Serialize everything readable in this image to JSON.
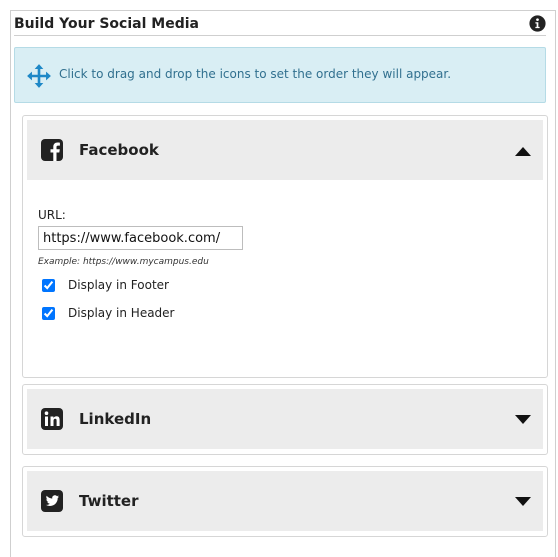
{
  "panel": {
    "title": "Build Your Social Media",
    "info_icon": "info-icon"
  },
  "notice": {
    "icon": "move-arrows-icon",
    "text": "Click to drag and drop the icons to set the order they will appear."
  },
  "accordions": [
    {
      "id": "facebook",
      "title": "Facebook",
      "icon": "facebook-icon",
      "expanded": true,
      "url_label": "URL:",
      "url_value": "https://www.facebook.com/",
      "example_text": "Example: https://www.mycampus.edu",
      "options": [
        {
          "label": "Display in Footer",
          "checked": true
        },
        {
          "label": "Display in Header",
          "checked": true
        }
      ]
    },
    {
      "id": "linkedin",
      "title": "LinkedIn",
      "icon": "linkedin-icon",
      "expanded": false
    },
    {
      "id": "twitter",
      "title": "Twitter",
      "icon": "twitter-icon",
      "expanded": false
    }
  ],
  "colors": {
    "notice_bg": "#d9eef4",
    "notice_text": "#31708f",
    "header_bg": "#ececec",
    "icon_dark": "#222222"
  }
}
